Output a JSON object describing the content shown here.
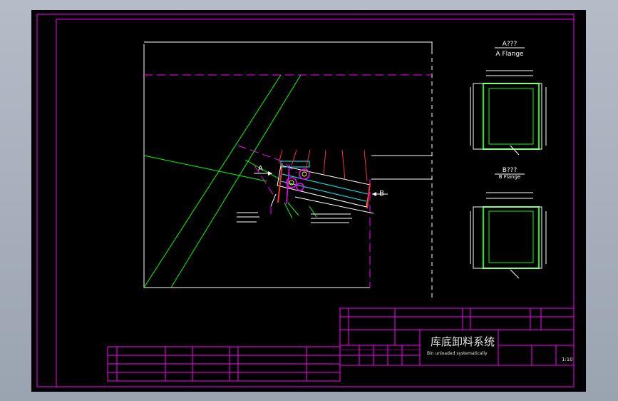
{
  "colors": {
    "background": "#000000",
    "frame": "#ff00ff",
    "outline": "#ffffff",
    "green": "#00ff00",
    "cyan": "#00ffff",
    "red": "#ff3030",
    "yellow": "#ffff00",
    "blue": "#4060ff"
  },
  "section_a": {
    "title": "A???",
    "subtitle": "A Flange"
  },
  "section_b": {
    "title": "B???",
    "subtitle": "B Flange"
  },
  "markers": {
    "a": "A",
    "b": "B"
  },
  "title_block": {
    "drawing_title": "库底卸料系统",
    "drawing_subtitle": "Bin unloaded systematically",
    "scale": "1:10"
  }
}
